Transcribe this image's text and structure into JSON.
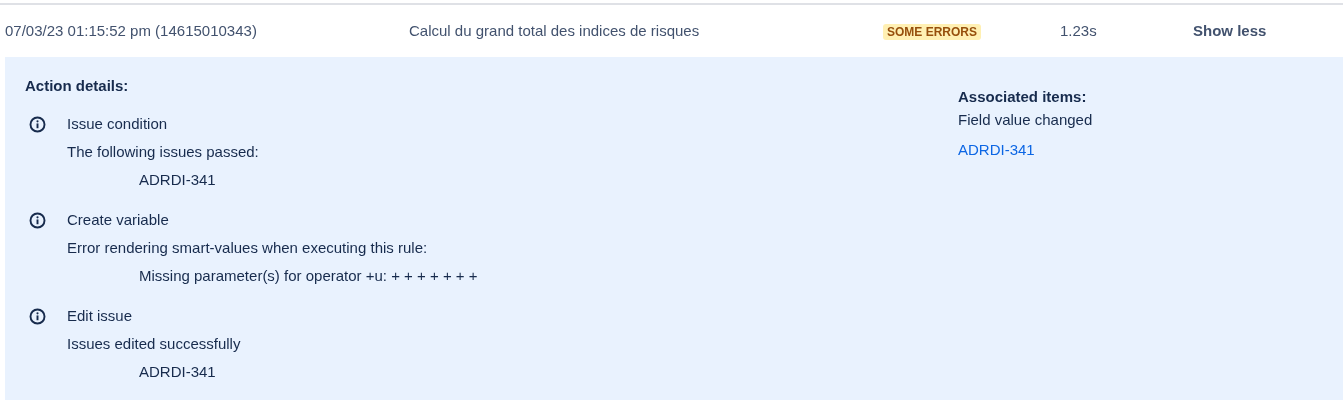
{
  "row": {
    "timestamp": "07/03/23 01:15:52 pm (14615010343)",
    "rule": "Calcul du grand total des indices de risques",
    "status": {
      "label": "SOME ERRORS",
      "kind": "warning"
    },
    "duration": "1.23s",
    "toggle": "Show less"
  },
  "details": {
    "heading": "Action details:",
    "actions": [
      {
        "title": "Issue condition",
        "message": "The following issues passed:",
        "items": [
          "ADRDI-341"
        ]
      },
      {
        "title": "Create variable",
        "message": "Error rendering smart-values when executing this rule:",
        "items": [
          "Missing parameter(s) for operator +u: + + + + + + +"
        ]
      },
      {
        "title": "Edit issue",
        "message": "Issues edited successfully",
        "items": [
          "ADRDI-341"
        ]
      }
    ]
  },
  "associated": {
    "heading": "Associated items:",
    "event": "Field value changed",
    "links": [
      "ADRDI-341"
    ]
  }
}
